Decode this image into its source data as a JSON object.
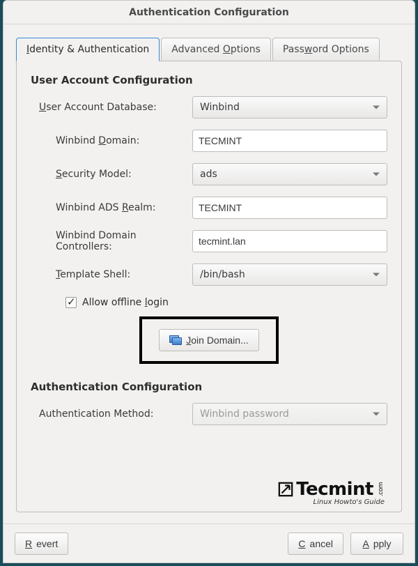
{
  "window": {
    "title": "Authentication Configuration"
  },
  "tabs": {
    "identity": "Identity & Authentication",
    "advanced": "Advanced Options",
    "password": "Password Options"
  },
  "section": {
    "user_account": "User Account Configuration",
    "auth_config": "Authentication Configuration"
  },
  "labels": {
    "user_db": "User Account Database:",
    "winbind_domain": "Winbind Domain:",
    "security_model": "Security Model:",
    "ads_realm": "Winbind ADS Realm:",
    "domain_controllers": "Winbind Domain Controllers:",
    "template_shell": "Template Shell:",
    "allow_offline": "Allow offline login",
    "auth_method": "Authentication Method:"
  },
  "values": {
    "user_db": "Winbind",
    "winbind_domain": "TECMINT",
    "security_model": "ads",
    "ads_realm": "TECMINT",
    "domain_controllers": "tecmint.lan",
    "template_shell": "/bin/bash",
    "allow_offline_checked": true,
    "auth_method": "Winbind password"
  },
  "buttons": {
    "join_domain": "Join Domain...",
    "revert": "Revert",
    "cancel": "Cancel",
    "apply": "Apply"
  },
  "watermark": {
    "brand": "Tecmint",
    "suffix": ".com",
    "tagline": "Linux Howto's Guide"
  }
}
